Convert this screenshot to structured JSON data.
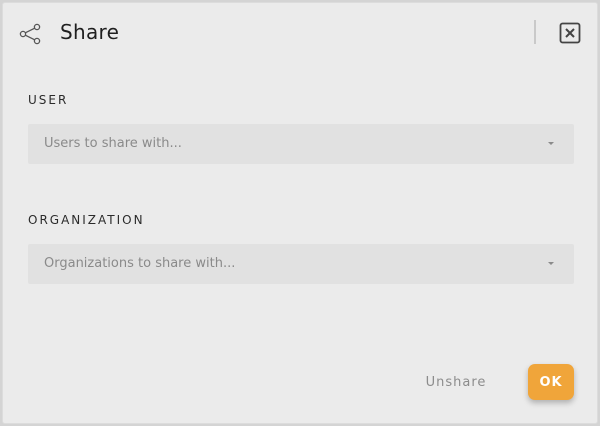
{
  "dialog": {
    "title": "Share",
    "header_icon": "share-icon",
    "close_icon": "close-icon"
  },
  "user": {
    "label": "USER",
    "placeholder": "Users to share with..."
  },
  "organization": {
    "label": "ORGANIZATION",
    "placeholder": "Organizations to share with..."
  },
  "footer": {
    "unshare_label": "Unshare",
    "ok_label": "OK"
  },
  "colors": {
    "accent": "#f0a53a",
    "background": "#ebebeb",
    "field_background": "#e1e1e1"
  }
}
